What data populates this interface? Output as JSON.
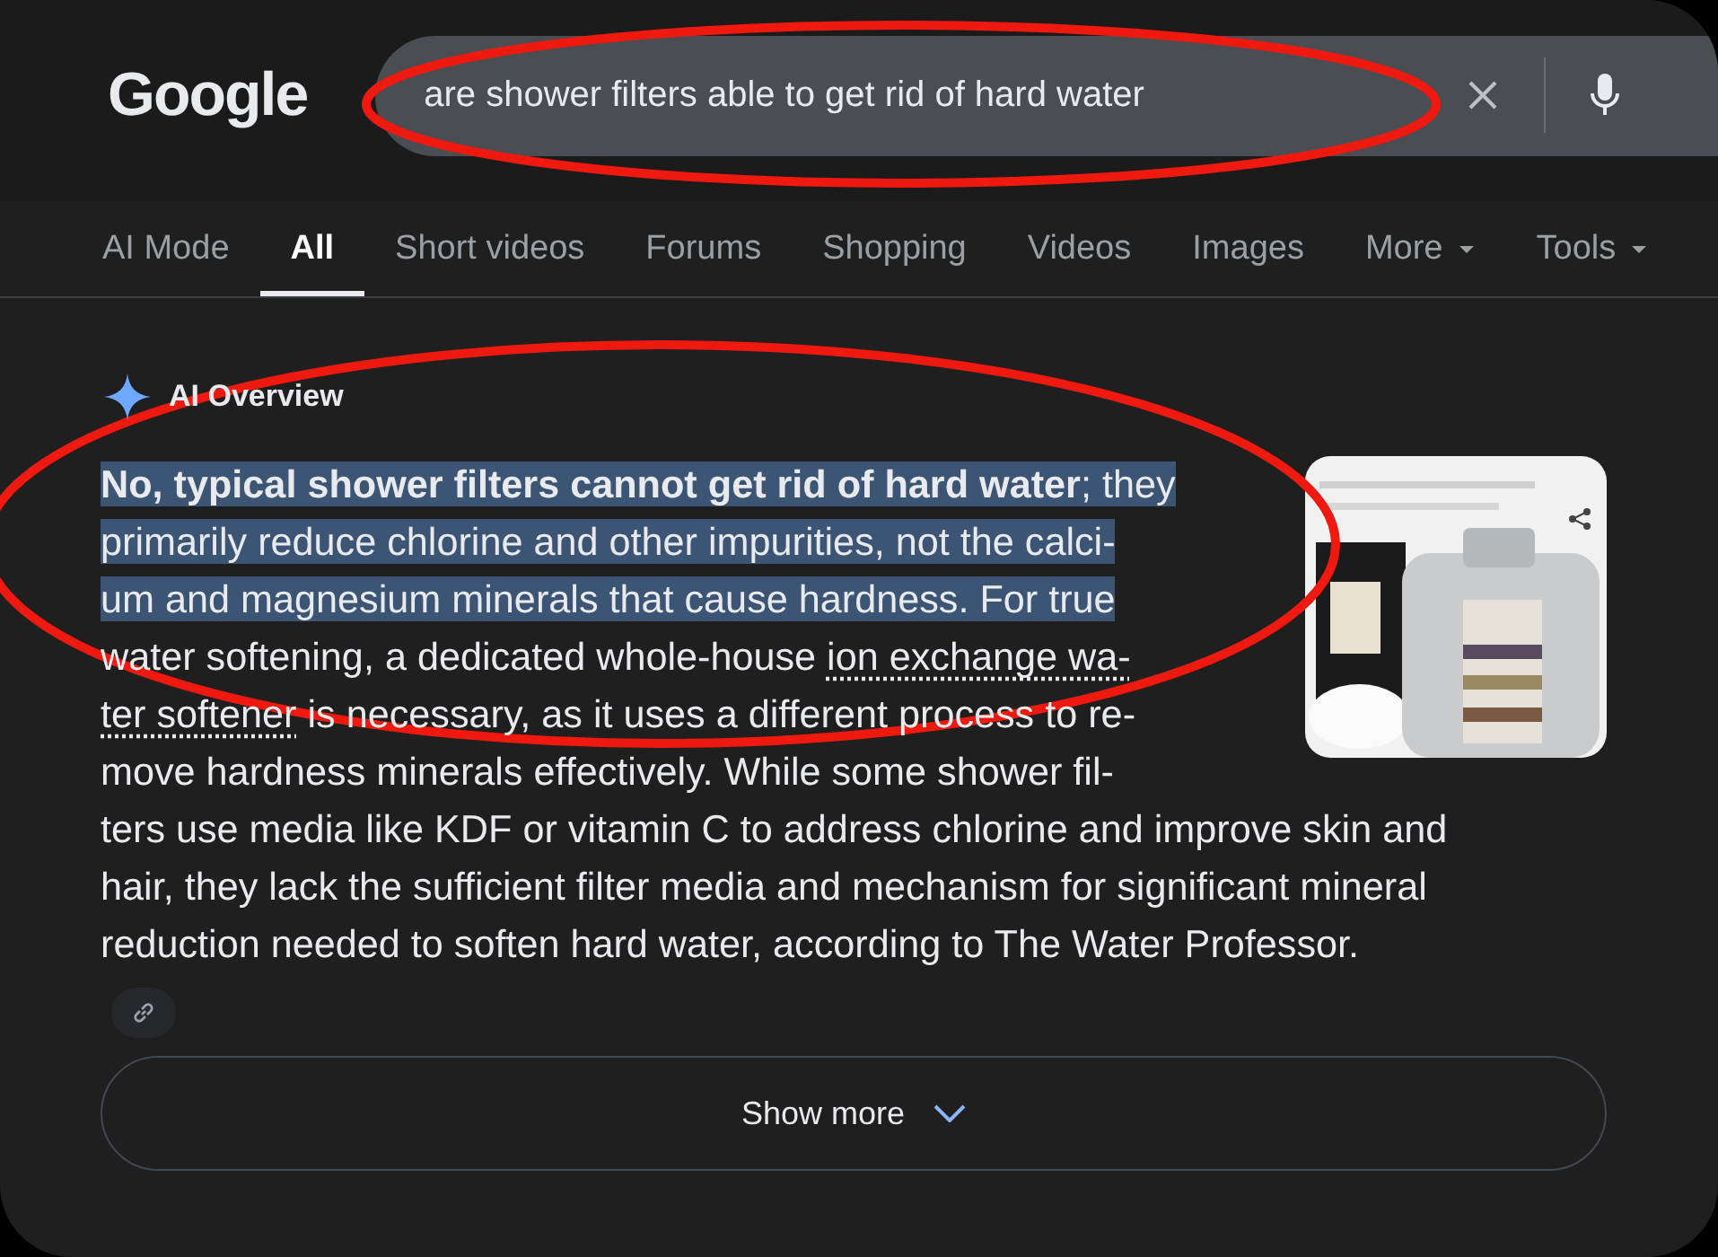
{
  "logo": "Google",
  "search": {
    "value": "are shower filters able to get rid of hard water"
  },
  "tabs": [
    {
      "label": "AI Mode",
      "selected": false,
      "dropdown": false
    },
    {
      "label": "All",
      "selected": true,
      "dropdown": false
    },
    {
      "label": "Short videos",
      "selected": false,
      "dropdown": false
    },
    {
      "label": "Forums",
      "selected": false,
      "dropdown": false
    },
    {
      "label": "Shopping",
      "selected": false,
      "dropdown": false
    },
    {
      "label": "Videos",
      "selected": false,
      "dropdown": false
    },
    {
      "label": "Images",
      "selected": false,
      "dropdown": false
    },
    {
      "label": "More",
      "selected": false,
      "dropdown": true
    },
    {
      "label": "Tools",
      "selected": false,
      "dropdown": true
    }
  ],
  "overview": {
    "title": "AI Overview",
    "lines": [
      {
        "selected": true,
        "parts": [
          {
            "kind": "bold",
            "text": "No, typical shower filters cannot get rid of hard water"
          },
          {
            "kind": "plain",
            "text": "; they"
          }
        ]
      },
      {
        "selected": true,
        "parts": [
          {
            "kind": "plain",
            "text": "primarily reduce chlorine and other impurities, not the calci-"
          }
        ]
      },
      {
        "selected": true,
        "parts": [
          {
            "kind": "plain",
            "text": "um and magnesium minerals that cause hardness. For true"
          }
        ]
      },
      {
        "selected": false,
        "parts": [
          {
            "kind": "plain",
            "text": "water softening, a dedicated whole-house "
          },
          {
            "kind": "link",
            "text": "ion exchange wa-"
          }
        ]
      },
      {
        "selected": false,
        "parts": [
          {
            "kind": "link",
            "text": "ter softener"
          },
          {
            "kind": "plain",
            "text": " is necessary, as it uses a different process to re-"
          }
        ]
      },
      {
        "selected": false,
        "parts": [
          {
            "kind": "plain",
            "text": "move hardness minerals effectively. While some shower fil-"
          }
        ]
      },
      {
        "selected": false,
        "parts": [
          {
            "kind": "plain",
            "text": "ters use media like KDF or vitamin C to address chlorine and improve skin and"
          }
        ]
      },
      {
        "selected": false,
        "parts": [
          {
            "kind": "plain",
            "text": "hair, they lack the sufficient filter media and mechanism for significant mineral"
          }
        ]
      },
      {
        "selected": false,
        "parts": [
          {
            "kind": "plain",
            "text": "reduction needed to soften hard water, according to The Water Professor."
          }
        ]
      }
    ],
    "show_more": "Show more"
  }
}
